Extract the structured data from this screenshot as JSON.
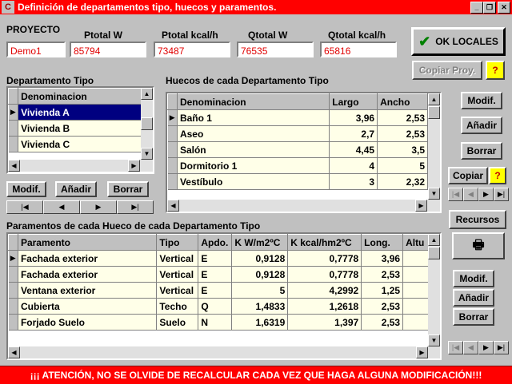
{
  "window": {
    "title": "Definición de departamentos tipo,  huecos y paramentos."
  },
  "proyecto": {
    "section_label": "PROYECTO",
    "fields": [
      {
        "label": "",
        "value": "Demo1"
      },
      {
        "label": "Ptotal W",
        "value": "85794"
      },
      {
        "label": "Ptotal kcal/h",
        "value": "73487"
      },
      {
        "label": "Qtotal W",
        "value": "76535"
      },
      {
        "label": "Qtotal kcal/h",
        "value": "65816"
      }
    ],
    "ok_label": "OK LOCALES",
    "copiar_label": "Copiar Proy.",
    "help_label": "?"
  },
  "departamento": {
    "title": "Departamento Tipo",
    "header": "Denominacion",
    "rows": [
      "Vivienda A",
      "Vivienda B",
      "Vivienda C"
    ],
    "selected": 0,
    "buttons": {
      "modif": "Modif.",
      "anadir": "Añadir",
      "borrar": "Borrar"
    }
  },
  "huecos": {
    "title": "Huecos de cada Departamento Tipo",
    "headers": [
      "Denominacion",
      "Largo",
      "Ancho"
    ],
    "rows": [
      [
        "Baño 1",
        "3,96",
        "2,53"
      ],
      [
        "Aseo",
        "2,7",
        "2,53"
      ],
      [
        "Salón",
        "4,45",
        "3,5"
      ],
      [
        "Dormitorio 1",
        "4",
        "5"
      ],
      [
        "Vestíbulo",
        "3",
        "2,32"
      ]
    ],
    "buttons": {
      "modif": "Modif.",
      "anadir": "Añadir",
      "borrar": "Borrar",
      "copiar": "Copiar",
      "help": "?"
    }
  },
  "paramentos": {
    "title": "Paramentos de cada Hueco de cada Departamento Tipo",
    "headers": [
      "Paramento",
      "Tipo",
      "Apdo.",
      "K W/m2ºC",
      "K kcal/hm2ºC",
      "Long.",
      "Altu"
    ],
    "rows": [
      [
        "Fachada exterior",
        "Vertical",
        "E",
        "0,9128",
        "0,7778",
        "3,96",
        ""
      ],
      [
        "Fachada exterior",
        "Vertical",
        "E",
        "0,9128",
        "0,7778",
        "2,53",
        ""
      ],
      [
        "Ventana exterior",
        "Vertical",
        "E",
        "5",
        "4,2992",
        "1,25",
        ""
      ],
      [
        "Cubierta",
        "Techo",
        "Q",
        "1,4833",
        "1,2618",
        "2,53",
        ""
      ],
      [
        "Forjado Suelo",
        "Suelo",
        "N",
        "1,6319",
        "1,397",
        "2,53",
        ""
      ]
    ],
    "buttons": {
      "recursos": "Recursos",
      "modif": "Modif.",
      "anadir": "Añadir",
      "borrar": "Borrar"
    }
  },
  "warning": "¡¡¡ ATENCIÓN, NO SE OLVIDE DE RECALCULAR CADA VEZ QUE HAGA ALGUNA MODIFICACIÓN!!!"
}
